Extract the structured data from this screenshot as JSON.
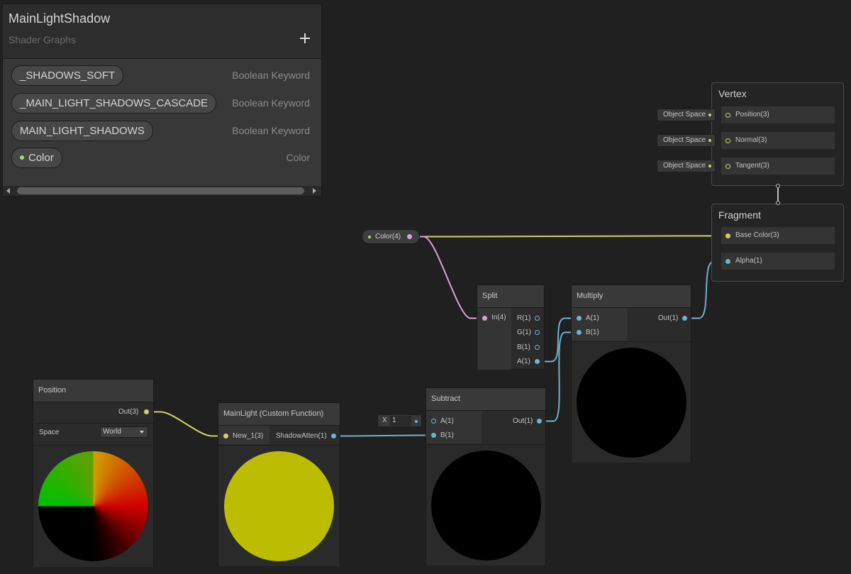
{
  "blackboard": {
    "title": "MainLightShadow",
    "subtitle": "Shader Graphs",
    "add_icon": "plus-icon",
    "properties": [
      {
        "name": "_SHADOWS_SOFT",
        "type": "Boolean Keyword"
      },
      {
        "name": "_MAIN_LIGHT_SHADOWS_CASCADE",
        "type": "Boolean Keyword"
      },
      {
        "name": "MAIN_LIGHT_SHADOWS",
        "type": "Boolean Keyword"
      },
      {
        "name": "Color",
        "type": "Color"
      }
    ]
  },
  "colors": {
    "vector1": "#6fb3cf",
    "vector3": "#cfd06e",
    "vector4": "#d9a2d6",
    "color_dot": "#9be06c",
    "yellow_preview": "#bdbd00",
    "canvas": "#202020"
  },
  "nodes": {
    "vertex": {
      "title": "Vertex",
      "slots": [
        {
          "label": "Position(3)",
          "input": "Object Space"
        },
        {
          "label": "Normal(3)",
          "input": "Object Space"
        },
        {
          "label": "Tangent(3)",
          "input": "Object Space"
        }
      ]
    },
    "fragment": {
      "title": "Fragment",
      "slots": [
        {
          "label": "Base Color(3)"
        },
        {
          "label": "Alpha(1)"
        }
      ]
    },
    "color_property": {
      "label": "Color(4)"
    },
    "split": {
      "title": "Split",
      "input": "In(4)",
      "outputs": [
        "R(1)",
        "G(1)",
        "B(1)",
        "A(1)"
      ]
    },
    "multiply": {
      "title": "Multiply",
      "inputs": [
        "A(1)",
        "B(1)"
      ],
      "output": "Out(1)"
    },
    "position": {
      "title": "Position",
      "output": "Out(3)",
      "space_label": "Space",
      "space_value": "World"
    },
    "mainlight": {
      "title": "MainLight (Custom Function)",
      "input": "New_1(3)",
      "output": "ShadowAtten(1)"
    },
    "subtract": {
      "title": "Subtract",
      "inputs": [
        "A(1)",
        "B(1)"
      ],
      "output": "Out(1)",
      "inline_axis": "X",
      "inline_value": "1"
    }
  }
}
